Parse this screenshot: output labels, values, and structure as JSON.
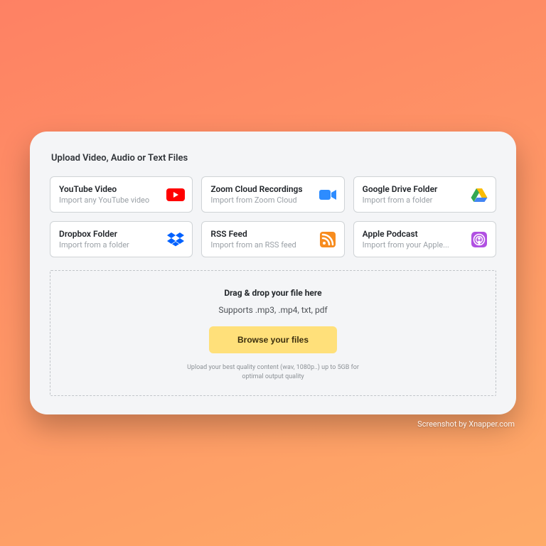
{
  "title": "Upload Video, Audio or Text Files",
  "sources": [
    {
      "id": "youtube",
      "label": "YouTube Video",
      "sub": "Import any YouTube video"
    },
    {
      "id": "zoom",
      "label": "Zoom Cloud Recordings",
      "sub": "Import from Zoom Cloud"
    },
    {
      "id": "gdrive",
      "label": "Google Drive Folder",
      "sub": "Import from a folder"
    },
    {
      "id": "dropbox",
      "label": "Dropbox Folder",
      "sub": "Import from a folder"
    },
    {
      "id": "rss",
      "label": "RSS Feed",
      "sub": "Import from an RSS feed"
    },
    {
      "id": "podcast",
      "label": "Apple Podcast",
      "sub": "Import from your Apple..."
    }
  ],
  "dropzone": {
    "title": "Drag & drop your file here",
    "supports": "Supports .mp3, .mp4, txt, pdf",
    "button": "Browse your files",
    "note": "Upload your best quality content (wav, 1080p..) up to 5GB for optimal output quality"
  },
  "watermark": "Screenshot by Xnapper.com"
}
